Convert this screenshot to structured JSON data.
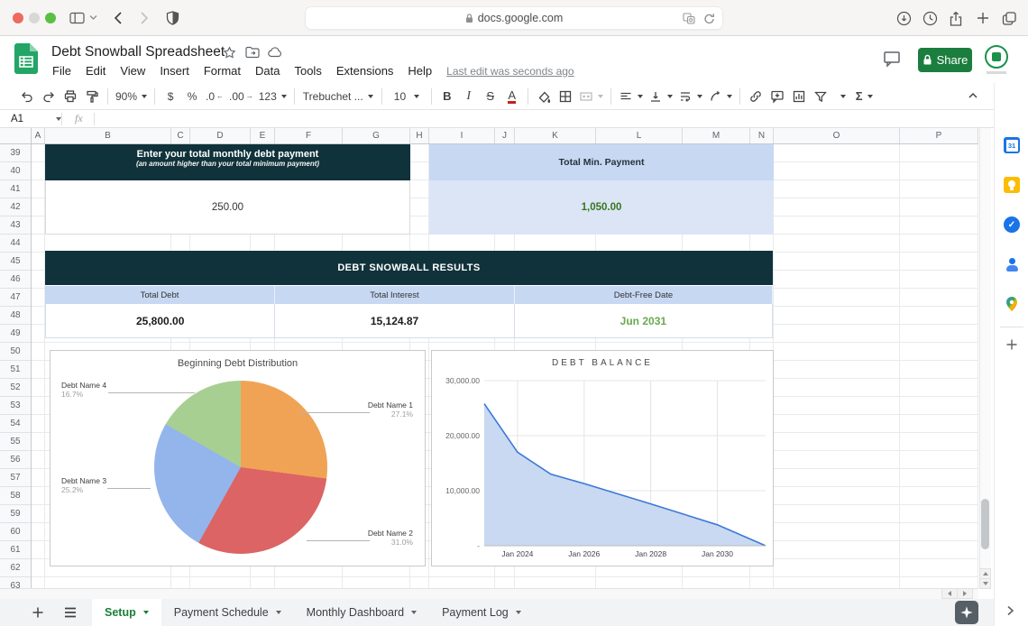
{
  "colors": {
    "accent_green": "#188038",
    "dark_banner": "#10323a",
    "blue_header": "#c7d8f2",
    "blue_body": "#dbe5f6",
    "value_green_dark": "#38761d",
    "value_green_light": "#6aa84f",
    "share_button": "#1b7e3e",
    "traffic_lights": [
      "#ec6a5e",
      "#d8d8d6",
      "#58c042"
    ]
  },
  "browser": {
    "url": "docs.google.com"
  },
  "header": {
    "title": "Debt Snowball Spreadsheet",
    "menu_items": [
      "File",
      "Edit",
      "View",
      "Insert",
      "Format",
      "Data",
      "Tools",
      "Extensions",
      "Help"
    ],
    "last_edit": "Last edit was seconds ago",
    "share_label": "Share"
  },
  "toolbar": {
    "zoom": "90%",
    "currency": "$",
    "percent": "%",
    "decimal_decrease": ".0",
    "decimal_increase": ".00",
    "number_format": "123",
    "font_name": "Trebuchet ...",
    "font_size": "10",
    "bold": "B",
    "italic": "I",
    "strikethrough": "S",
    "text_color": "A",
    "functions": "Σ"
  },
  "formula_bar": {
    "cell_reference": "A1",
    "fx_label": "fx"
  },
  "grid": {
    "column_letters": [
      "A",
      "B",
      "C",
      "D",
      "E",
      "F",
      "G",
      "H",
      "I",
      "J",
      "K",
      "L",
      "M",
      "N",
      "O",
      "P"
    ],
    "row_numbers": [
      39,
      40,
      41,
      42,
      43,
      44,
      45,
      46,
      47,
      48,
      49,
      50,
      51,
      52,
      53,
      54,
      55,
      56,
      57,
      58,
      59,
      60,
      61,
      62,
      63
    ]
  },
  "content": {
    "payment_box": {
      "title": "Enter your total monthly debt payment",
      "subtitle": "(an amount higher than your total minimum payment)",
      "value": "250.00"
    },
    "min_payment_box": {
      "label": "Total Min. Payment",
      "value": "1,050.00"
    },
    "results": {
      "title": "DEBT SNOWBALL RESULTS",
      "columns": [
        {
          "header": "Total Debt",
          "value": "25,800.00",
          "value_color": "#1c1c1c"
        },
        {
          "header": "Total Interest",
          "value": "15,124.87",
          "value_color": "#1c1c1c"
        },
        {
          "header": "Debt-Free Date",
          "value": "Jun 2031",
          "value_color": "#6aa84f"
        }
      ]
    }
  },
  "chart_data": [
    {
      "type": "pie",
      "title": "Beginning Debt Distribution",
      "labels": [
        "Debt Name 1",
        "Debt Name 2",
        "Debt Name 3",
        "Debt Name 4"
      ],
      "values": [
        27.1,
        31.0,
        25.2,
        16.7
      ],
      "value_labels": [
        "27.1%",
        "31.0%",
        "25.2%",
        "16.7%"
      ],
      "colors": [
        "#f0a355",
        "#dd6464",
        "#93b5ec",
        "#a8cf92"
      ],
      "legend_position": "outside-callouts"
    },
    {
      "type": "area",
      "title": "DEBT BALANCE",
      "x": [
        2023.0,
        2024.0,
        2025.0,
        2026.0,
        2028.0,
        2030.0,
        2031.45
      ],
      "x_labels": [
        "Jan 2023",
        "Jan 2024",
        "Jan 2025",
        "Jan 2026",
        "Jan 2028",
        "Jan 2030",
        "Jun 2031"
      ],
      "y": [
        25800,
        17000,
        13000,
        11300,
        7600,
        3800,
        0
      ],
      "x_ticks": [
        {
          "v": 2024,
          "label": "Jan 2024"
        },
        {
          "v": 2026,
          "label": "Jan 2026"
        },
        {
          "v": 2028,
          "label": "Jan 2028"
        },
        {
          "v": 2030,
          "label": "Jan 2030"
        }
      ],
      "y_ticks": [
        {
          "v": 0,
          "label": "-"
        },
        {
          "v": 10000,
          "label": "10,000.00"
        },
        {
          "v": 20000,
          "label": "20,000.00"
        },
        {
          "v": 30000,
          "label": "30,000.00"
        }
      ],
      "xlim": [
        2023.0,
        2031.45
      ],
      "ylim": [
        0,
        30000
      ],
      "grid": true,
      "line_color": "#3d78d8",
      "fill_color": "#c8d9f1"
    }
  ],
  "tabs": {
    "items": [
      {
        "label": "Setup",
        "active": true
      },
      {
        "label": "Payment Schedule",
        "active": false
      },
      {
        "label": "Monthly Dashboard",
        "active": false
      },
      {
        "label": "Payment Log",
        "active": false
      }
    ]
  },
  "side_panel": {
    "calendar_day": "31",
    "tasks_check": "✓",
    "apps": [
      "calendar",
      "keep",
      "tasks",
      "contacts",
      "maps"
    ]
  }
}
